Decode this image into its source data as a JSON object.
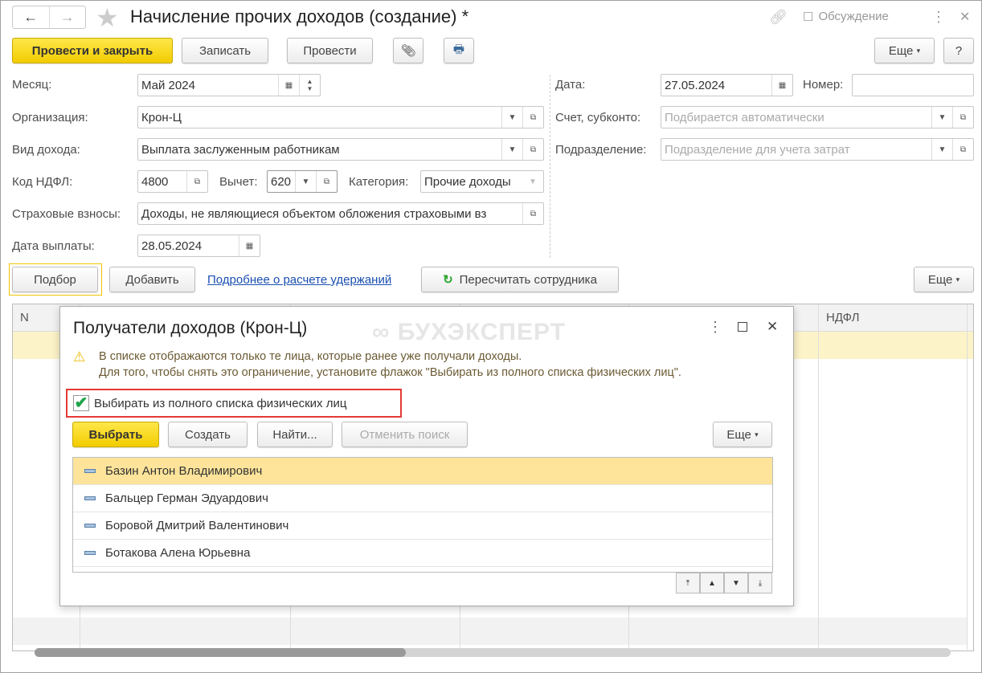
{
  "window": {
    "title": "Начисление прочих доходов (создание) *",
    "discussion": "Обсуждение"
  },
  "toolbar": {
    "post_close": "Провести и закрыть",
    "save": "Записать",
    "post": "Провести",
    "more": "Еще",
    "help": "?"
  },
  "form": {
    "month_label": "Месяц:",
    "month": "Май 2024",
    "org_label": "Организация:",
    "org": "Крон-Ц",
    "income_type_label": "Вид дохода:",
    "income_type": "Выплата заслуженным работникам",
    "ndfl_code_label": "Код НДФЛ:",
    "ndfl_code": "4800",
    "deduction_label": "Вычет:",
    "deduction": "620",
    "category_label": "Категория:",
    "category": "Прочие доходы",
    "insurance_label": "Страховые взносы:",
    "insurance": "Доходы, не являющиеся объектом обложения страховыми вз",
    "pay_date_label": "Дата выплаты:",
    "pay_date": "28.05.2024",
    "date_label": "Дата:",
    "date": "27.05.2024",
    "number_label": "Номер:",
    "number": "",
    "account_label": "Счет, субконто:",
    "account_placeholder": "Подбирается автоматически",
    "dept_label": "Подразделение:",
    "dept_placeholder": "Подразделение для учета затрат"
  },
  "table_bar": {
    "pick": "Подбор",
    "add": "Добавить",
    "link": "Подробнее о расчете удержаний",
    "recalc": "Пересчитать сотрудника",
    "more": "Еще"
  },
  "table": {
    "col_n": "N",
    "col_ndfl": "НДФЛ"
  },
  "dialog": {
    "title": "Получатели доходов (Крон-Ц)",
    "watermark": "БУХЭКСПЕРТ",
    "warning_1": "В списке отображаются только те лица, которые ранее уже получали доходы.",
    "warning_2": "Для того, чтобы снять это ограничение, установите флажок \"Выбирать из полного списка физических лиц\".",
    "checkbox_label": "Выбирать из полного списка физических лиц",
    "checkbox_checked": true,
    "select": "Выбрать",
    "create": "Создать",
    "find": "Найти...",
    "cancel_search": "Отменить поиск",
    "more": "Еще",
    "people": [
      "Базин Антон Владимирович",
      "Бальцер Герман Эдуардович",
      "Боровой Дмитрий Валентинович",
      "Ботакова Алена Юрьевна"
    ]
  }
}
